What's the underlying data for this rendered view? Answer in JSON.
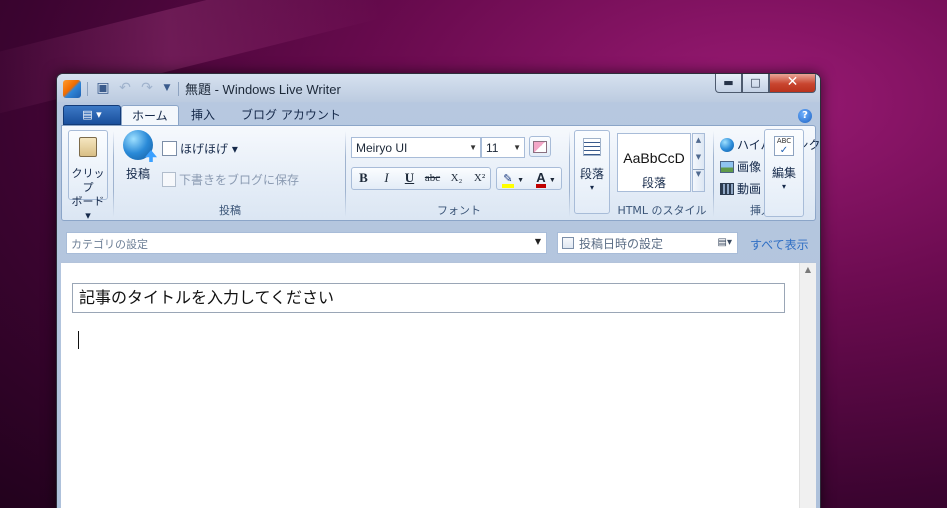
{
  "window": {
    "title": "無題 - Windows Live Writer",
    "minimize_glyph": "▬",
    "maximize_glyph": "□",
    "close_glyph": "✕"
  },
  "quick_access": {
    "save_icon": "save-icon",
    "undo_icon": "undo-icon",
    "redo_icon": "redo-icon",
    "customize_icon": "chevron-down-icon"
  },
  "ribbon_tabs": [
    {
      "label": "ホーム",
      "active": true
    },
    {
      "label": "挿入",
      "active": false
    },
    {
      "label": "ブログ アカウント",
      "active": false
    }
  ],
  "app_menu_glyph": "▤ ▾",
  "help_glyph": "?",
  "groups": {
    "clipboard": {
      "button_line1": "クリップ",
      "button_line2": "ボード ▾"
    },
    "post": {
      "label": "投稿",
      "publish_label": "投稿",
      "blog_selector": "ほげほげ ▾",
      "save_draft": "下書きをブログに保存"
    },
    "font": {
      "label": "フォント",
      "font_name": "Meiryo UI",
      "font_size": "11",
      "bold": "B",
      "italic": "I",
      "underline": "U",
      "strikethrough": "abc",
      "subscript": "X₂",
      "superscript": "X²",
      "font_color": "A",
      "highlight_color": "#ffff00",
      "text_color": "#c00000"
    },
    "paragraph": {
      "label_line1": "段落",
      "label_line2": "▾"
    },
    "html_style": {
      "label": "HTML のスタイル",
      "sample": "AaBbCcD",
      "style_name": "段落"
    },
    "insert": {
      "label": "挿入",
      "hyperlink": "ハイパーリンク",
      "image": "画像 ▾",
      "video": "動画 ▾"
    },
    "edit": {
      "label_line1": "編集",
      "label_line2": "▾"
    }
  },
  "category_bar": {
    "category_placeholder": "カテゴリの設定",
    "publish_date": "投稿日時の設定",
    "show_all": "すべて表示"
  },
  "editor": {
    "title_placeholder": "記事のタイトルを入力してください"
  },
  "colors": {
    "accent": "#1a4f9c",
    "link": "#2f6fc4",
    "close_button": "#c8452f"
  }
}
